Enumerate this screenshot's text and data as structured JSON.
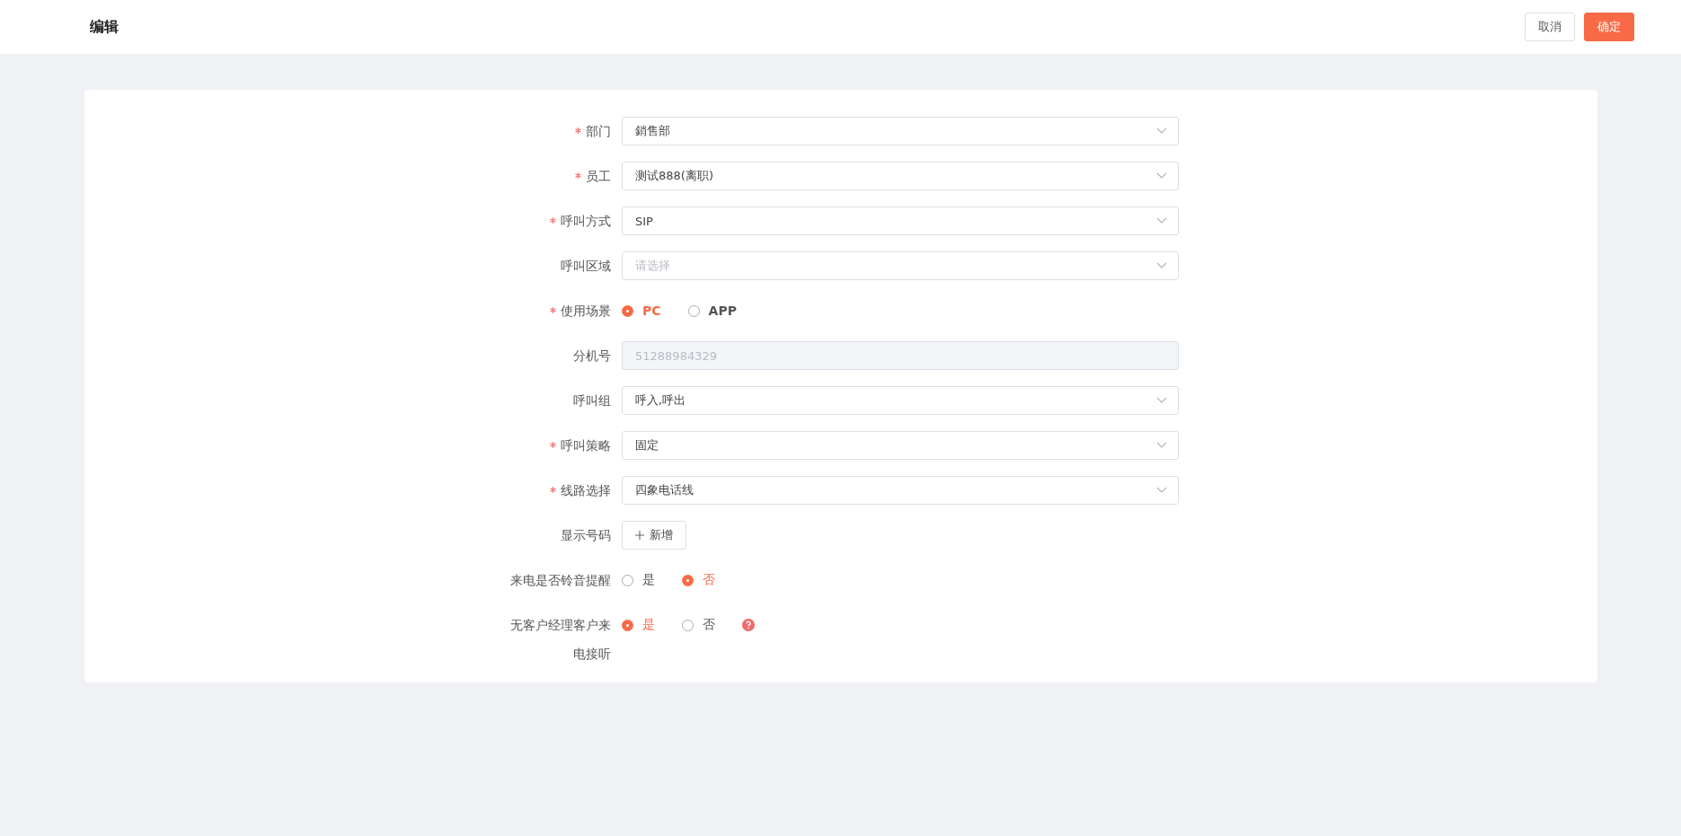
{
  "header": {
    "title": "编辑",
    "buttons": [
      {
        "label": "取消",
        "kind": "default"
      },
      {
        "label": "确定",
        "kind": "primary"
      }
    ]
  },
  "form": [
    {
      "label": "部门",
      "required": true,
      "kind": "select",
      "value": "銷售部"
    },
    {
      "label": "员工",
      "required": true,
      "kind": "select",
      "value": "测试888(离职)"
    },
    {
      "label": "呼叫方式",
      "required": true,
      "kind": "select",
      "value": "SIP"
    },
    {
      "label": "呼叫区域",
      "required": false,
      "kind": "select",
      "placeholder": "请选择"
    },
    {
      "label": "使用场景",
      "required": true,
      "kind": "radio",
      "bold": true,
      "options": [
        {
          "label": "PC",
          "selected": true
        },
        {
          "label": "APP",
          "selected": false
        }
      ]
    },
    {
      "label": "分机号",
      "required": false,
      "kind": "input",
      "disabled": true,
      "value": "51288984329"
    },
    {
      "label": "呼叫组",
      "required": false,
      "kind": "select",
      "value": "呼入,呼出"
    },
    {
      "label": "呼叫策略",
      "required": true,
      "kind": "select",
      "value": "固定"
    },
    {
      "label": "线路选择",
      "required": true,
      "kind": "select",
      "value": "四象电话线"
    },
    {
      "label": "显示号码",
      "required": false,
      "kind": "button",
      "button": "新增"
    },
    {
      "label": "来电是否铃音提醒",
      "required": false,
      "kind": "radio",
      "bold": false,
      "options": [
        {
          "label": "是",
          "selected": false
        },
        {
          "label": "否",
          "selected": true
        }
      ]
    },
    {
      "label": "无客户经理客户来电接听",
      "required": false,
      "kind": "radio",
      "bold": false,
      "help": true,
      "options": [
        {
          "label": "是",
          "selected": true
        },
        {
          "label": "否",
          "selected": false
        }
      ]
    }
  ]
}
